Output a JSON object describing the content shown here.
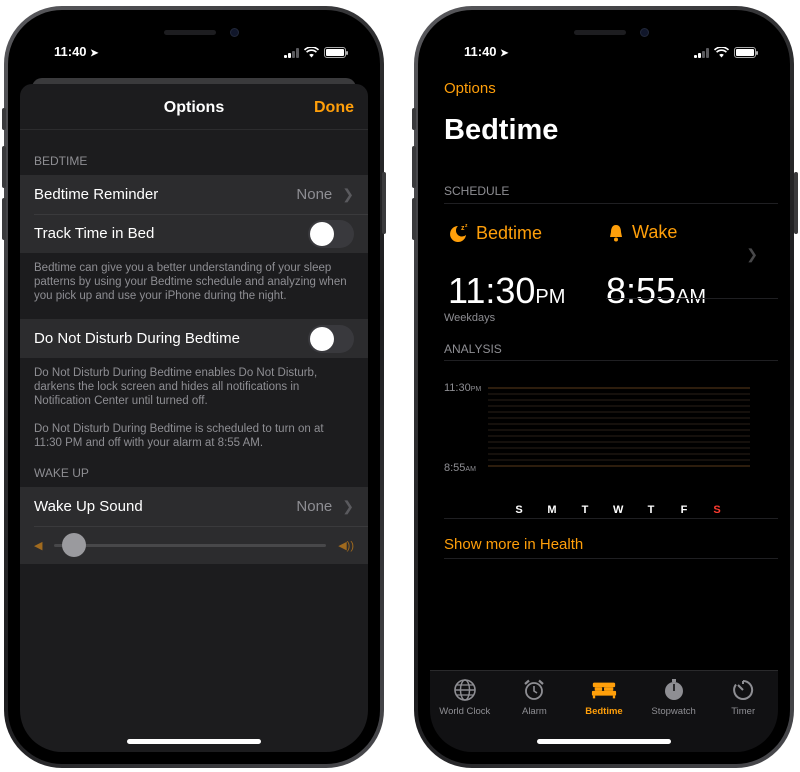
{
  "left": {
    "status": {
      "time": "11:40"
    },
    "sheet": {
      "title": "Options",
      "done": "Done",
      "bedtime_section": "BEDTIME",
      "reminder": {
        "label": "Bedtime Reminder",
        "value": "None"
      },
      "track": {
        "label": "Track Time in Bed",
        "on": false
      },
      "track_note": "Bedtime can give you a better understanding of your sleep patterns by using your Bedtime schedule and analyzing when you pick up and use your iPhone during the night.",
      "dnd": {
        "label": "Do Not Disturb During Bedtime",
        "on": false
      },
      "dnd_note1": "Do Not Disturb During Bedtime enables Do Not Disturb, darkens the lock screen and hides all notifications in Notification Center until turned off.",
      "dnd_note2": "Do Not Disturb During Bedtime is scheduled to turn on at 11:30 PM and off with your alarm at 8:55 AM.",
      "wake_section": "WAKE UP",
      "wake_sound": {
        "label": "Wake Up Sound",
        "value": "None"
      },
      "volume_level": 0.05
    }
  },
  "right": {
    "status": {
      "time": "11:40"
    },
    "options_link": "Options",
    "title": "Bedtime",
    "schedule_label": "SCHEDULE",
    "bedtime_head": "Bedtime",
    "wake_head": "Wake",
    "bedtime_time": "11:30",
    "bedtime_ampm": "PM",
    "wake_time": "8:55",
    "wake_ampm": "AM",
    "weekdays": "Weekdays",
    "analysis_label": "ANALYSIS",
    "analysis": {
      "y_top": "11:30",
      "y_top_suffix": "PM",
      "y_bottom": "8:55",
      "y_bottom_suffix": "AM",
      "days": [
        "S",
        "M",
        "T",
        "W",
        "T",
        "F",
        "S"
      ],
      "highlight_day_index": 6
    },
    "health_link": "Show more in Health",
    "tabs": [
      {
        "label": "World Clock",
        "icon": "globe-icon"
      },
      {
        "label": "Alarm",
        "icon": "alarm-clock-icon"
      },
      {
        "label": "Bedtime",
        "icon": "bed-icon",
        "active": true
      },
      {
        "label": "Stopwatch",
        "icon": "stopwatch-icon"
      },
      {
        "label": "Timer",
        "icon": "timer-icon"
      }
    ],
    "accent_color": "#ff9f0a"
  }
}
